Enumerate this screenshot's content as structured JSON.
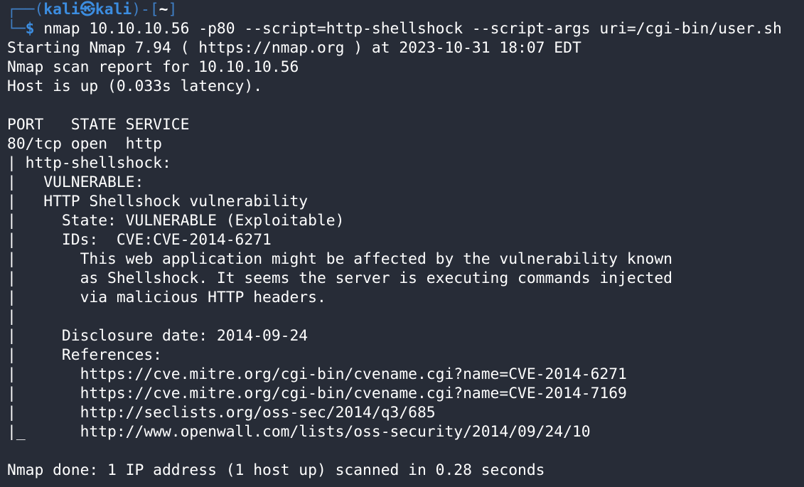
{
  "prompt": {
    "box_open": "┌──(",
    "user": "kali",
    "separator": "㉿",
    "host": "kali",
    "box_mid": ")-[",
    "cwd": "~",
    "box_close": "]",
    "box_bottom": "└─",
    "symbol": "$",
    "command": " nmap 10.10.10.56 -p80 --script=http-shellshock --script-args uri=/cgi-bin/user.sh"
  },
  "output": {
    "lines": [
      "Starting Nmap 7.94 ( https://nmap.org ) at 2023-10-31 18:07 EDT",
      "Nmap scan report for 10.10.10.56",
      "Host is up (0.033s latency).",
      "",
      "PORT   STATE SERVICE",
      "80/tcp open  http",
      "| http-shellshock:",
      "|   VULNERABLE:",
      "|   HTTP Shellshock vulnerability",
      "|     State: VULNERABLE (Exploitable)",
      "|     IDs:  CVE:CVE-2014-6271",
      "|       This web application might be affected by the vulnerability known",
      "|       as Shellshock. It seems the server is executing commands injected",
      "|       via malicious HTTP headers.",
      "|",
      "|     Disclosure date: 2014-09-24",
      "|     References:",
      "|       https://cve.mitre.org/cgi-bin/cvename.cgi?name=CVE-2014-6271",
      "|       https://cve.mitre.org/cgi-bin/cvename.cgi?name=CVE-2014-7169",
      "|       http://seclists.org/oss-sec/2014/q3/685",
      "|_      http://www.openwall.com/lists/oss-security/2014/09/24/10",
      "",
      "Nmap done: 1 IP address (1 host up) scanned in 0.28 seconds"
    ]
  }
}
